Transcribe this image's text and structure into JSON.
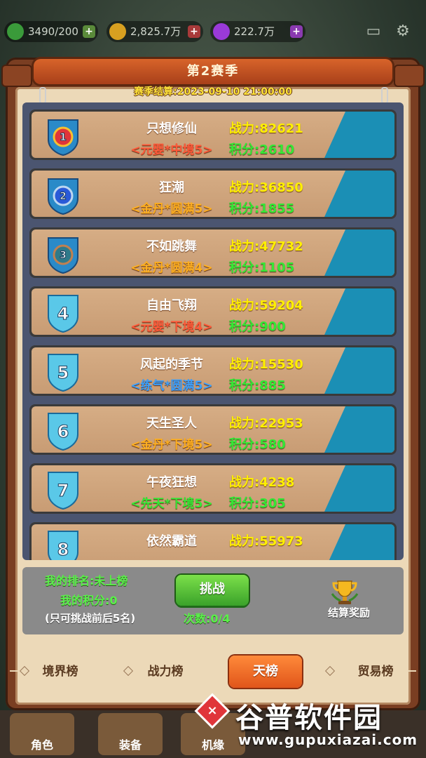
{
  "resources": {
    "stamina": "3490/200",
    "gold": "2,825.7万",
    "gem": "222.7万"
  },
  "panel": {
    "title": "第2赛季",
    "settle_time": "赛季结算:2023-09-10 21:00:00"
  },
  "ranking": [
    {
      "rank": "1",
      "name": "只想修仙",
      "realm": "<元婴*中境5>",
      "realm_color": "#ff5a3a",
      "power": "战力:82621",
      "score": "积分:2610"
    },
    {
      "rank": "2",
      "name": "狂潮",
      "realm": "<金丹*圆满5>",
      "realm_color": "#ffb020",
      "power": "战力:36850",
      "score": "积分:1855"
    },
    {
      "rank": "3",
      "name": "不如跳舞",
      "realm": "<金丹*圆满4>",
      "realm_color": "#ffb020",
      "power": "战力:47732",
      "score": "积分:1105"
    },
    {
      "rank": "4",
      "name": "自由飞翔",
      "realm": "<元婴*下境4>",
      "realm_color": "#ff5a3a",
      "power": "战力:59204",
      "score": "积分:900"
    },
    {
      "rank": "5",
      "name": "风起的季节",
      "realm": "<练气*圆满5>",
      "realm_color": "#3aa0ff",
      "power": "战力:15530",
      "score": "积分:885"
    },
    {
      "rank": "6",
      "name": "天生圣人",
      "realm": "<金丹*下境5>",
      "realm_color": "#ffb020",
      "power": "战力:22953",
      "score": "积分:580"
    },
    {
      "rank": "7",
      "name": "午夜狂想",
      "realm": "<先天*下境5>",
      "realm_color": "#35e835",
      "power": "战力:4238",
      "score": "积分:305"
    },
    {
      "rank": "8",
      "name": "依然霸道",
      "realm": "",
      "realm_color": "#ffb020",
      "power": "战力:55973",
      "score": ""
    }
  ],
  "my_info": {
    "my_rank": "我的排名:未上榜",
    "my_score": "我的积分:0",
    "note": "(只可挑战前后5名)",
    "challenge_label": "挑战",
    "count": "次数:0/4",
    "reward_label": "结算奖励"
  },
  "tabs": {
    "realm": "境界榜",
    "power": "战力榜",
    "sky": "天榜",
    "trade": "贸易榜"
  },
  "bottom_nav": {
    "role": "角色",
    "equip": "装备",
    "fate": "机缘",
    "close": "×"
  },
  "watermark": {
    "title": "谷普软件园",
    "url": "www.gupuxiazai.com"
  },
  "colors": {
    "frame": "#7a3e22",
    "parchment": "#ecd9b8",
    "list_bg": "#4b5570",
    "card_accent": "#1b8fb5",
    "power_text": "#fff000",
    "score_text": "#35e835"
  }
}
